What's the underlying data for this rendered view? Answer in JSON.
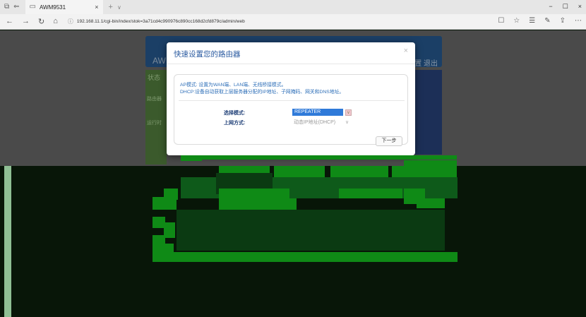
{
  "browser": {
    "tab_title": "AWM9531",
    "tab_close": "×",
    "tab_add": "+",
    "tab_more": "∨",
    "url": "192.168.11.1/cgi-bin/index/stok=3a71cd4c990976c890cc168d2cfd879c/admin/web",
    "window_controls": [
      "−",
      "☐",
      "×"
    ],
    "nav_icons": [
      "←",
      "→",
      "↻",
      "⌂"
    ],
    "right_icons": [
      "☐",
      "☆",
      "☰",
      "✎",
      "⇪",
      "⋯"
    ]
  },
  "router_page": {
    "brand": "AW",
    "logout": "置 退出",
    "status_tab": "状态",
    "side_items": [
      "路由器",
      "运行时"
    ]
  },
  "modal": {
    "title": "快速设置您的路由器",
    "close": "×",
    "desc_line1": "AP模式: 设置为WAN端、LAN端、无线桥接模式。",
    "desc_line2": "DHCP:设备自动获取上层服务器分配的IP地址、子网掩码、网关和DNS地址。",
    "mode_label": "选择模式:",
    "mode_value": "REPEATER",
    "internet_label": "上网方式:",
    "internet_value": "动态IP地址(DHCP)",
    "next_button": "下一步"
  }
}
